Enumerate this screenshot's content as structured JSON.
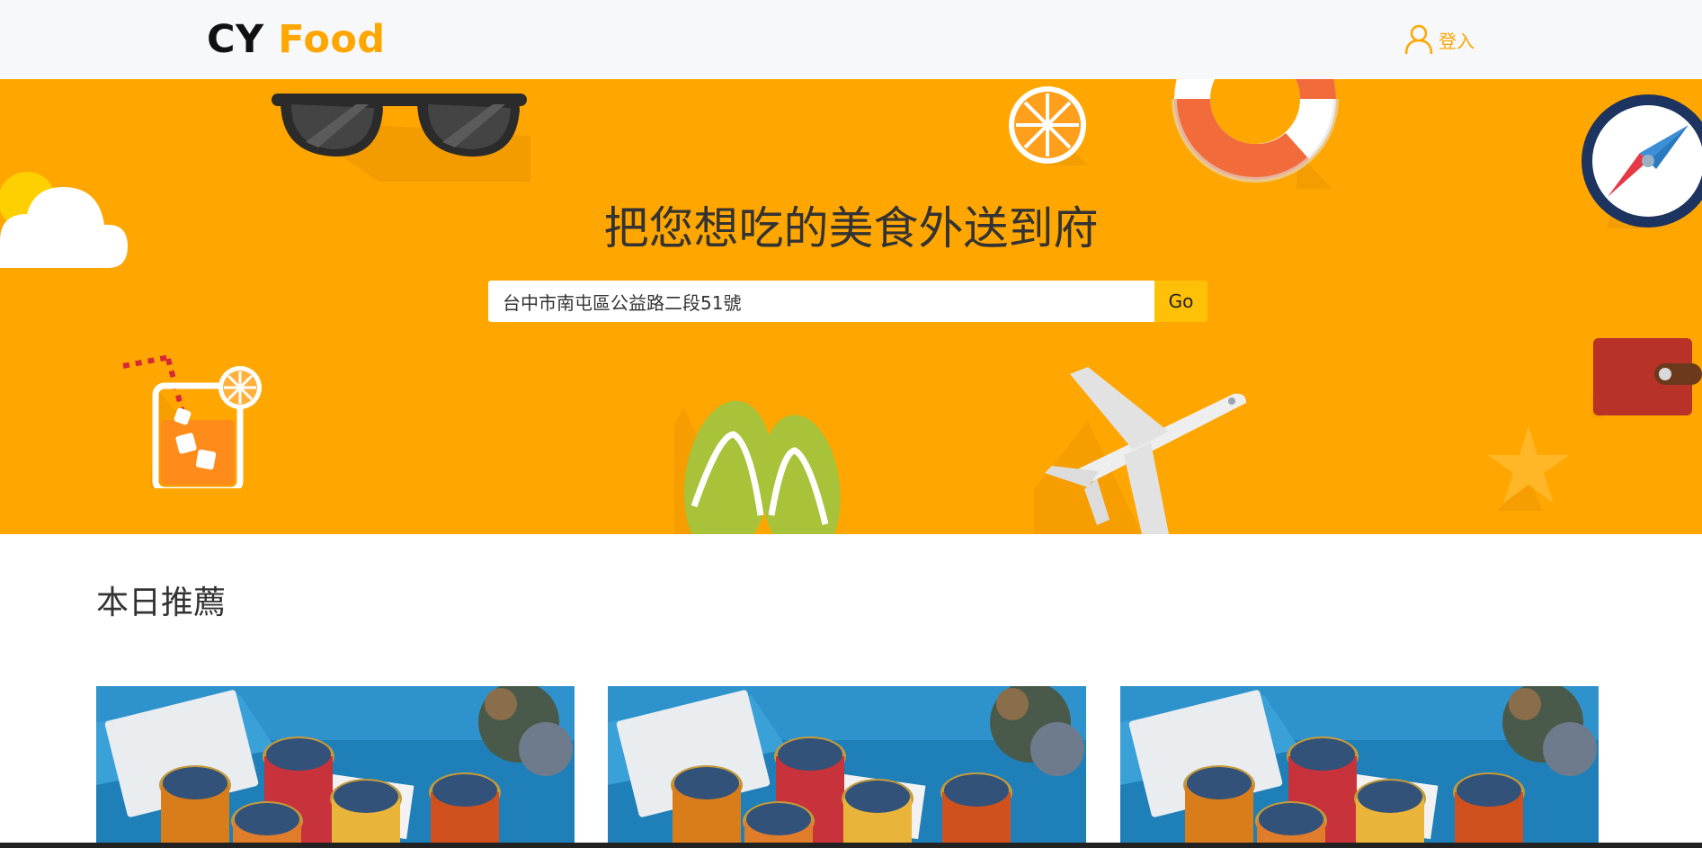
{
  "header": {
    "logo_part1": "CY",
    "logo_part2": "Food",
    "login_label": "登入"
  },
  "hero": {
    "title": "把您想吃的美食外送到府",
    "search_value": "台中市南屯區公益路二段51號",
    "go_label": "Go",
    "icons": [
      "sunglasses-icon",
      "orange-slice-icon",
      "life-ring-icon",
      "compass-icon",
      "cloud-icon",
      "iced-drink-icon",
      "flip-flops-icon",
      "airplane-icon",
      "wallet-icon",
      "starfish-icon"
    ]
  },
  "recommend": {
    "title": "本日推薦",
    "cards": [
      {
        "image": "drinks-photo"
      },
      {
        "image": "drinks-photo"
      },
      {
        "image": "drinks-photo"
      }
    ]
  },
  "colors": {
    "brand": "#ffa600",
    "go_button": "#ffc107",
    "topbar_bg": "#f7f8fa"
  }
}
